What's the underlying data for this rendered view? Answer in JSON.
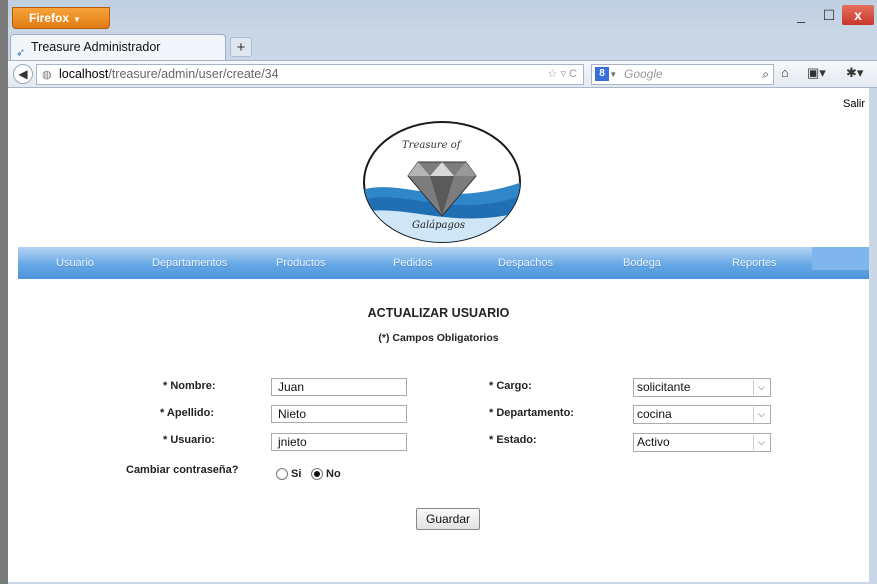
{
  "browser": {
    "app_button": "Firefox",
    "window_controls": {
      "minimize": "_",
      "maximize": "☐",
      "close": "x"
    },
    "tab_title": "Treasure Administrador",
    "new_tab": "+",
    "url_host": "localhost",
    "url_path": "/treasure/admin/user/create/34",
    "search_placeholder": "Google",
    "search_engine_letter": "8"
  },
  "page": {
    "salir": "Salir",
    "logo_text_top": "Treasure of",
    "logo_text_bottom": "Galápagos",
    "menu": [
      "Usuario",
      "Departamentos",
      "Productos",
      "Pedidos",
      "Despachos",
      "Bodega",
      "Reportes"
    ],
    "title": "ACTUALIZAR USUARIO",
    "subtitle": "(*) Campos Obligatorios",
    "form": {
      "nombre_label": "* Nombre:",
      "nombre_value": "Juan",
      "apellido_label": "* Apellido:",
      "apellido_value": "Nieto",
      "usuario_label": "* Usuario:",
      "usuario_value": "jnieto",
      "cargo_label": "* Cargo:",
      "cargo_value": "solicitante",
      "departamento_label": "* Departamento:",
      "departamento_value": "cocina",
      "estado_label": "* Estado:",
      "estado_value": "Activo",
      "cambiar_label": "Cambiar contraseña?",
      "radio_si": "Si",
      "radio_no": "No",
      "radio_selected": "No",
      "submit_label": "Guardar"
    }
  },
  "colors": {
    "menu_bar": "#5a9de0",
    "firefox_orange": "#e8891f",
    "close_red": "#c8372a"
  }
}
